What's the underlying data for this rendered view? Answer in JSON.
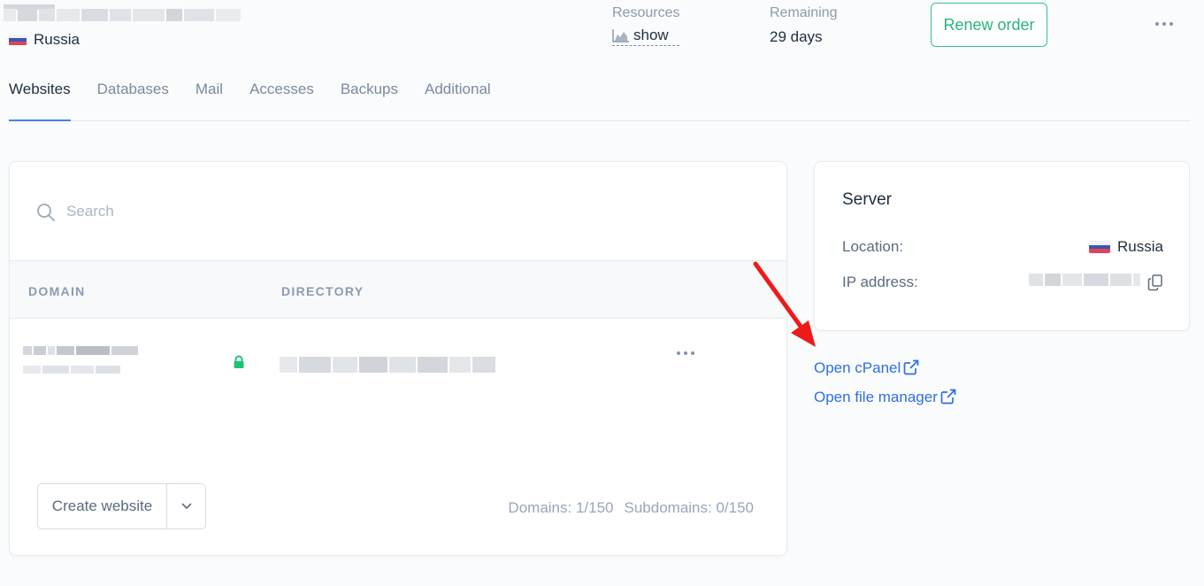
{
  "header": {
    "location": "Russia",
    "resources_label": "Resources",
    "resources_value": "show",
    "remaining_label": "Remaining",
    "remaining_value": "29 days",
    "renew_button": "Renew order"
  },
  "tabs": [
    {
      "label": "Websites",
      "active": true
    },
    {
      "label": "Databases"
    },
    {
      "label": "Mail"
    },
    {
      "label": "Accesses"
    },
    {
      "label": "Backups"
    },
    {
      "label": "Additional"
    }
  ],
  "websites": {
    "search_placeholder": "Search",
    "columns": {
      "domain": "DOMAIN",
      "directory": "DIRECTORY"
    },
    "create_button": "Create website",
    "domains_count": "Domains: 1/150",
    "subdomains_count": "Subdomains: 0/150"
  },
  "server": {
    "title": "Server",
    "location_label": "Location:",
    "location_value": "Russia",
    "ip_label": "IP address:"
  },
  "links": {
    "cpanel": "Open cPanel",
    "file_manager": "Open file manager"
  },
  "colors": {
    "accent_green": "#27b57b",
    "link_blue": "#2f6fe0",
    "tab_active_underline": "#3e82f7",
    "annotation_arrow": "#ee1a1a"
  }
}
